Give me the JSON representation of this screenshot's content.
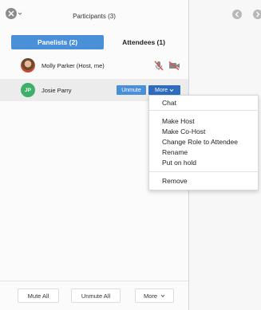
{
  "header": {
    "title": "Participants (3)"
  },
  "tabs": [
    {
      "label": "Panelists (2)",
      "active": true
    },
    {
      "label": "Attendees (1)",
      "active": false
    }
  ],
  "participants": [
    {
      "name": "Molly Parker (Host, me)",
      "avatar": "photo",
      "mic": "muted",
      "video": "off"
    },
    {
      "name": "Josie Parry",
      "avatar_initials": "JP",
      "avatar_color": "#3fb06a",
      "actions": {
        "unmute_label": "Unmute",
        "more_label": "More"
      }
    }
  ],
  "more_menu": {
    "items": [
      "Chat",
      "Make Host",
      "Make Co-Host",
      "Change Role to Attendee",
      "Rename",
      "Put on hold",
      "Remove"
    ]
  },
  "footer": {
    "mute_all": "Mute All",
    "unmute_all": "Unmute All",
    "more": "More"
  },
  "colors": {
    "accent": "#4a90d9",
    "more_button": "#2d6cc0",
    "muted_icon": "#d9534f"
  }
}
